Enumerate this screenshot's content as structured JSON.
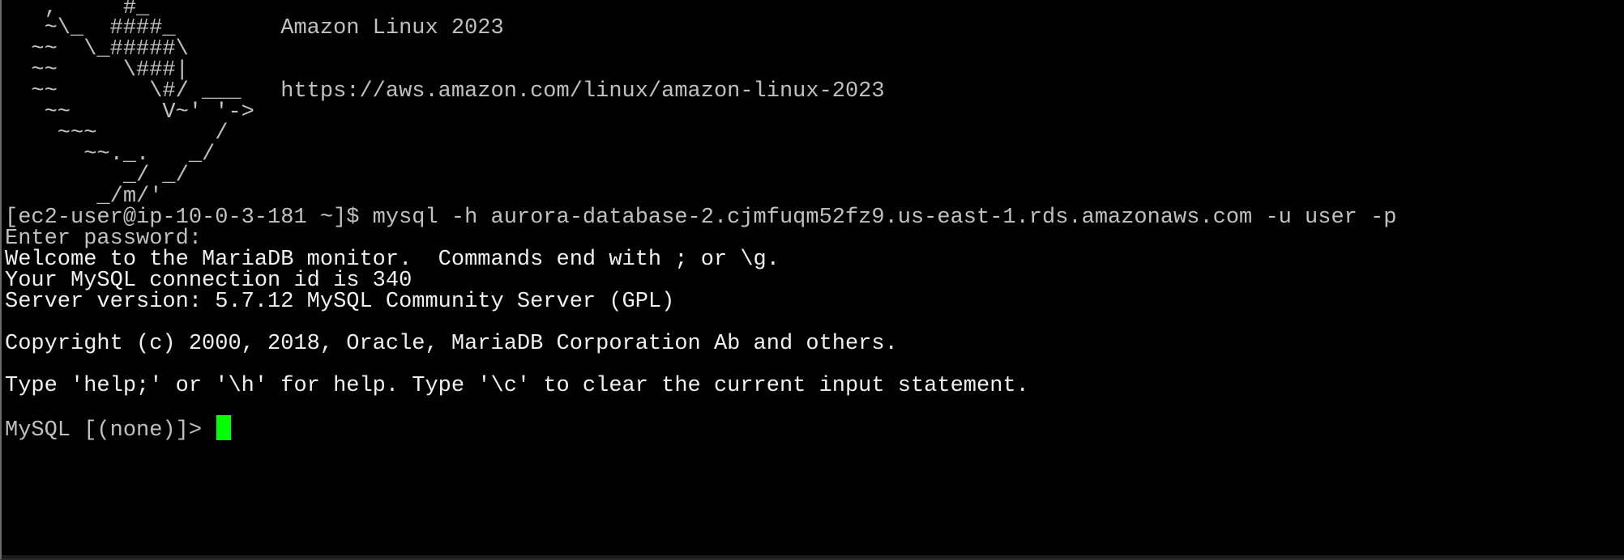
{
  "terminal": {
    "lines": [
      "   ,     #_",
      "   ~\\_  ####_        Amazon Linux 2023",
      "  ~~  \\_#####\\",
      "  ~~     \\###|",
      "  ~~       \\#/ ___   https://aws.amazon.com/linux/amazon-linux-2023",
      "   ~~       V~' '->",
      "    ~~~         /",
      "      ~~._.   _/",
      "         _/ _/",
      "       _/m/'",
      "[ec2-user@ip-10-0-3-181 ~]$ mysql -h aurora-database-2.cjmfuqm52fz9.us-east-1.rds.amazonaws.com -u user -p",
      "Enter password:",
      "Welcome to the MariaDB monitor.  Commands end with ; or \\g.",
      "Your MySQL connection id is 340",
      "Server version: 5.7.12 MySQL Community Server (GPL)",
      "",
      "Copyright (c) 2000, 2018, Oracle, MariaDB Corporation Ab and others.",
      "",
      "Type 'help;' or '\\h' for help. Type '\\c' to clear the current input statement.",
      ""
    ],
    "prompt": "MySQL [(none)]> ",
    "colors": {
      "background": "#000000",
      "foreground": "#c0c0c0",
      "cursor": "#00ff00"
    }
  }
}
